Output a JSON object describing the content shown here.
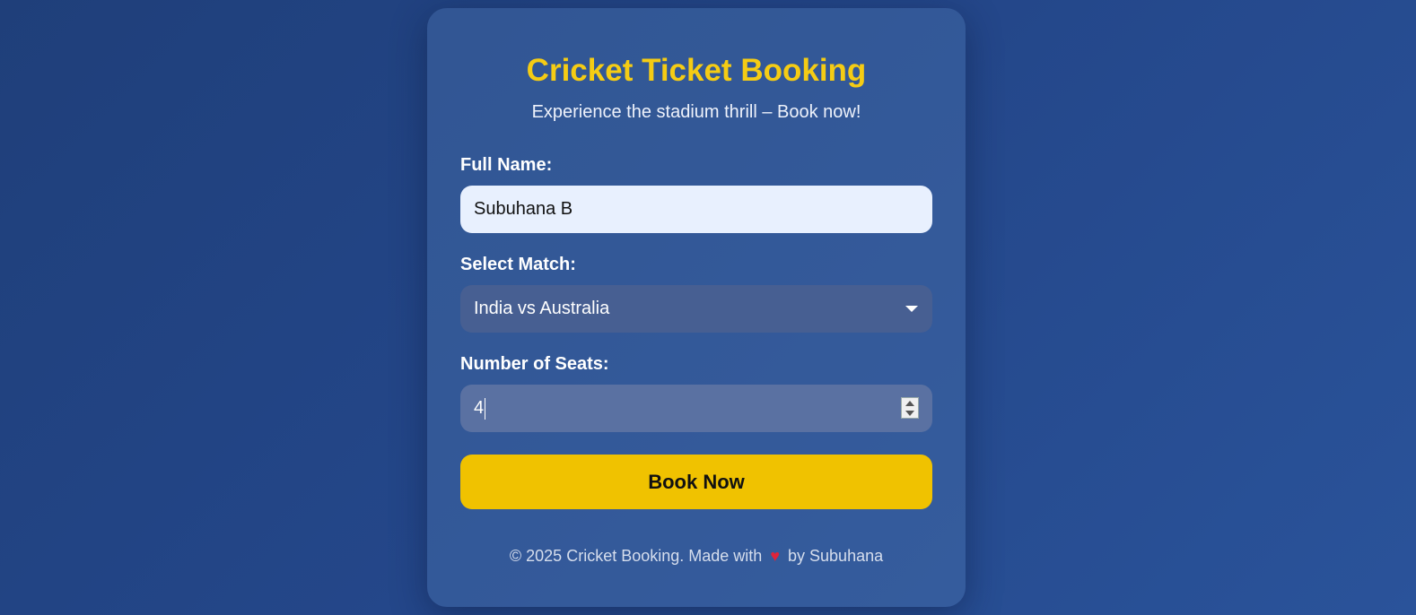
{
  "header": {
    "title": "Cricket Ticket Booking",
    "subtitle": "Experience the stadium thrill – Book now!"
  },
  "form": {
    "name_label": "Full Name:",
    "name_value": "Subuhana B",
    "match_label": "Select Match:",
    "match_selected": "India vs Australia",
    "seats_label": "Number of Seats:",
    "seats_value": "4",
    "submit_label": "Book Now"
  },
  "footer": {
    "prefix": "© 2025 Cricket Booking. Made with",
    "heart": "♥",
    "suffix": "by Subuhana"
  },
  "colors": {
    "accent": "#f5cc14",
    "button": "#f0c200",
    "background": "#24478a"
  },
  "icons": {
    "select_caret": "chevron-down-icon",
    "spinner": "number-spinner-icon",
    "footer_heart": "heart-icon"
  }
}
